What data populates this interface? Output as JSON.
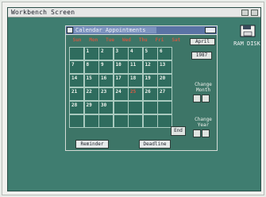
{
  "titlebar": {
    "title": "Workbench Screen"
  },
  "disk": {
    "label": "RAM DISK"
  },
  "window": {
    "title": "Calendar Appointments",
    "weekdays": [
      "Sun",
      "Mon",
      "Tue",
      "Wed",
      "Thu",
      "Fri",
      "Sat"
    ],
    "days": [
      "",
      "1",
      "2",
      "3",
      "4",
      "5",
      "6",
      "7",
      "8",
      "9",
      "10",
      "11",
      "12",
      "13",
      "14",
      "15",
      "16",
      "17",
      "18",
      "19",
      "20",
      "21",
      "22",
      "23",
      "24",
      "25",
      "26",
      "27",
      "28",
      "29",
      "30",
      "",
      "",
      "",
      "",
      "",
      "",
      "",
      "",
      "",
      "",
      ""
    ],
    "today": "25",
    "end_label": "End",
    "reminder_label": "Reminder",
    "deadline_label": "Deadline",
    "month_label": "April",
    "year_label": "1987",
    "change_month_label": "Change Month",
    "change_year_label": "Change Year"
  },
  "colors": {
    "screen": "#3f7d70",
    "accent": "#5a73a5",
    "weekday": "#c85a45"
  }
}
